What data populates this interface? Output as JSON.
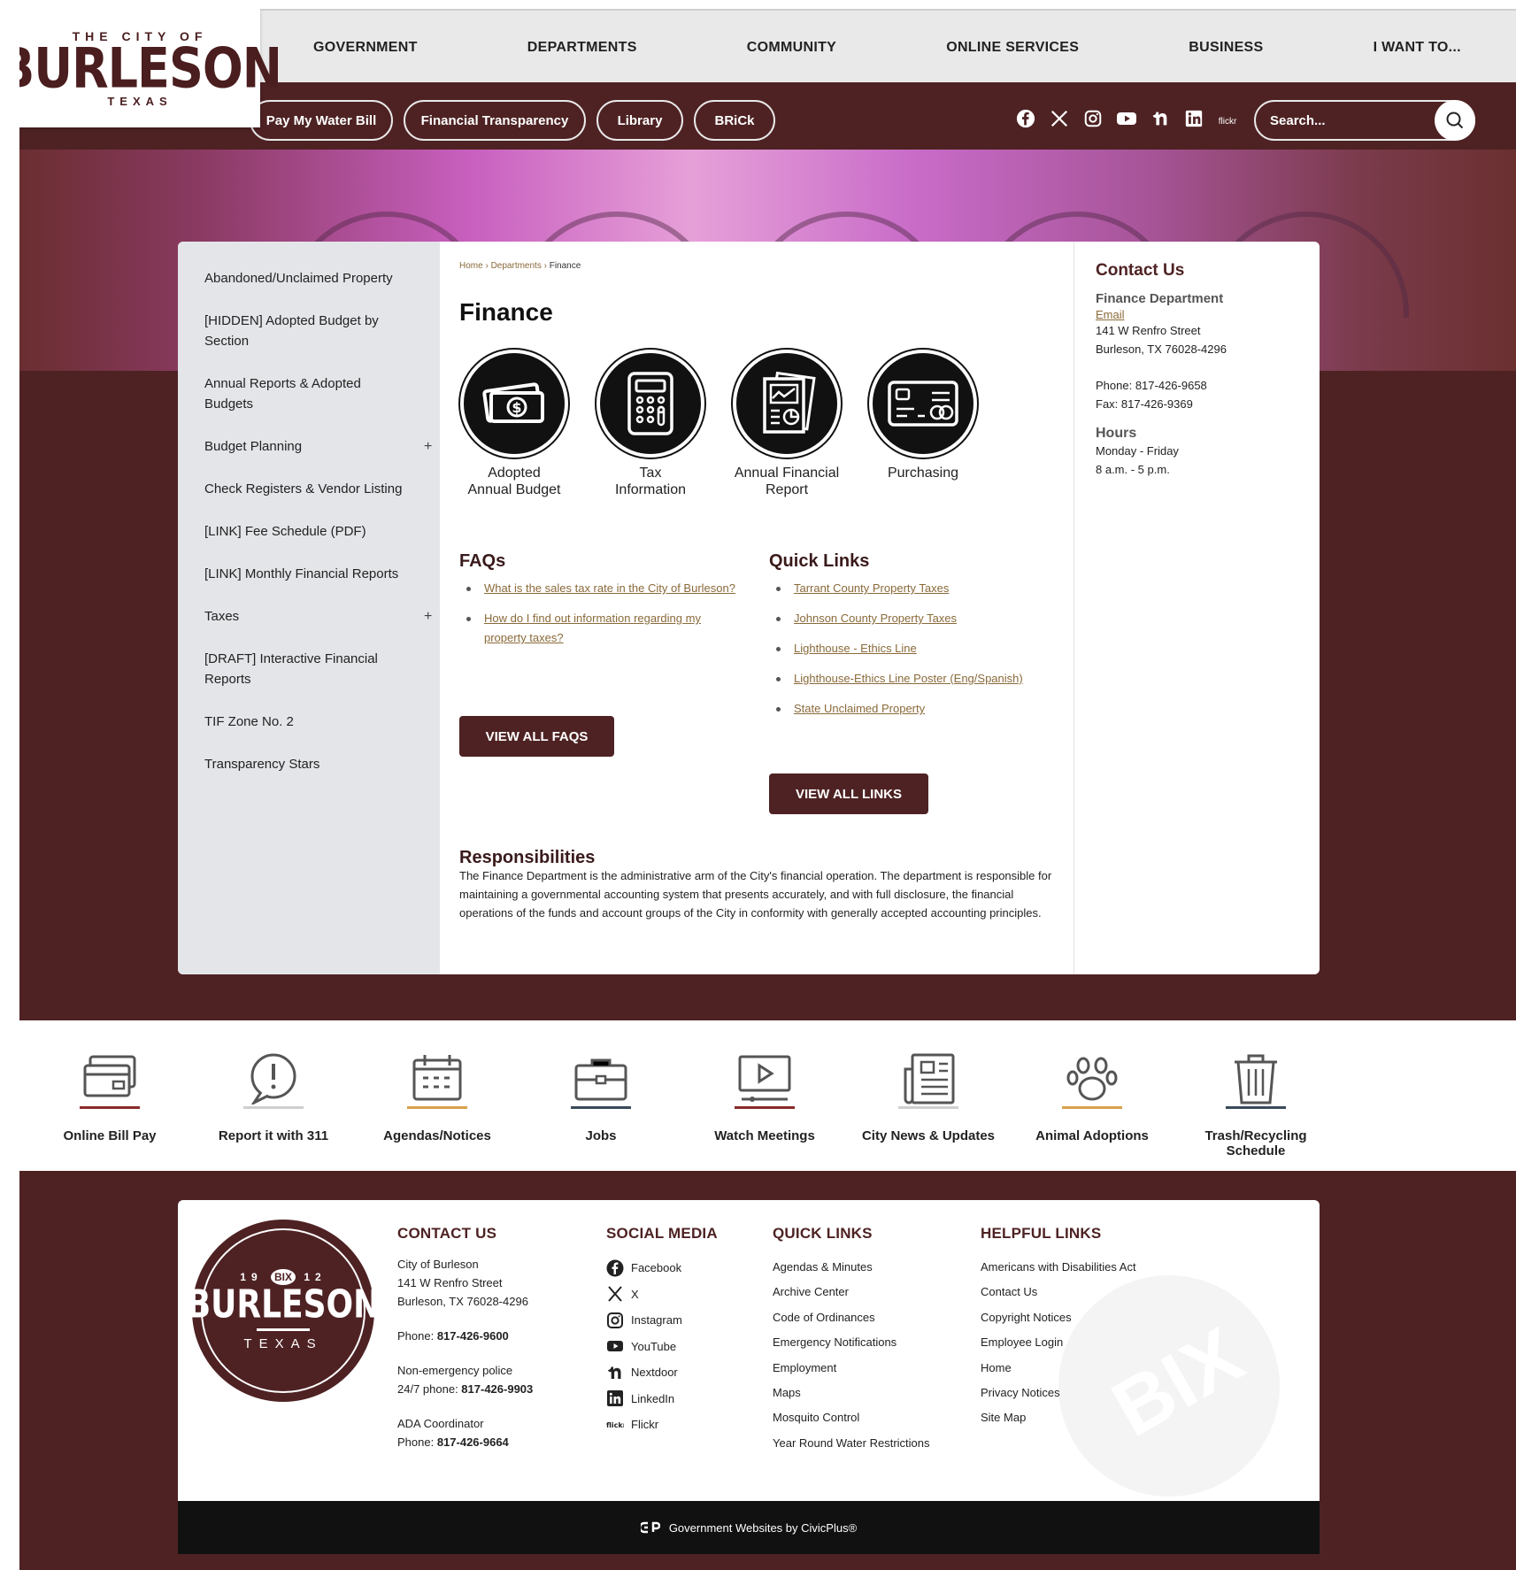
{
  "logo": {
    "top": "THE CITY OF",
    "name": "BURLESON",
    "state": "TEXAS"
  },
  "nav": [
    "GOVERNMENT",
    "DEPARTMENTS",
    "COMMUNITY",
    "ONLINE SERVICES",
    "BUSINESS",
    "I WANT TO..."
  ],
  "pills": [
    "Pay My Water Bill",
    "Financial Transparency",
    "Library",
    "BRiCk"
  ],
  "social_icons": [
    "facebook-icon",
    "x-icon",
    "instagram-icon",
    "youtube-icon",
    "nextdoor-icon",
    "linkedin-icon",
    "flickr-icon"
  ],
  "social_flickr_label": "flickr",
  "search": {
    "placeholder": "Search..."
  },
  "sidebar": {
    "items": [
      {
        "label": "Abandoned/Unclaimed Property",
        "expand": ""
      },
      {
        "label": "[HIDDEN] Adopted Budget by Section",
        "expand": ""
      },
      {
        "label": "Annual Reports & Adopted Budgets",
        "expand": ""
      },
      {
        "label": "Budget Planning",
        "expand": "+"
      },
      {
        "label": "Check Registers & Vendor Listing",
        "expand": ""
      },
      {
        "label": "[LINK] Fee Schedule (PDF)",
        "expand": ""
      },
      {
        "label": "[LINK] Monthly Financial Reports",
        "expand": ""
      },
      {
        "label": "Taxes",
        "expand": "+"
      },
      {
        "label": "[DRAFT] Interactive Financial Reports",
        "expand": ""
      },
      {
        "label": "TIF Zone No. 2",
        "expand": ""
      },
      {
        "label": "Transparency Stars",
        "expand": ""
      }
    ]
  },
  "breadcrumb": {
    "home": "Home",
    "sep": " › ",
    "departments": "Departments",
    "current": "Finance"
  },
  "page_title": "Finance",
  "icon_buttons": [
    {
      "label": "Adopted\nAnnual Budget",
      "icon": "money-icon"
    },
    {
      "label": "Tax\nInformation",
      "icon": "calculator-icon"
    },
    {
      "label": "Annual Financial\nReport",
      "icon": "report-icon"
    },
    {
      "label": "Purchasing",
      "icon": "credit-card-icon"
    }
  ],
  "faqs": {
    "heading": "FAQs",
    "items": [
      "What is the sales tax rate in the City of Burleson?",
      "How do I find out information regarding my property taxes?"
    ],
    "button": "VIEW ALL FAQS"
  },
  "quick_links": {
    "heading": "Quick Links",
    "items": [
      "Tarrant County Property Taxes",
      "Johnson County Property Taxes",
      "Lighthouse - Ethics Line",
      "Lighthouse-Ethics Line Poster (Eng/Spanish)",
      "State Unclaimed Property"
    ],
    "button": "VIEW ALL LINKS"
  },
  "responsibilities": {
    "heading": "Responsibilities",
    "text": "The Finance Department is the administrative arm of the City's financial operation. The department is responsible for maintaining a governmental accounting system that presents accurately, and with full disclosure, the financial operations of the funds and account groups of the City in conformity with generally accepted accounting principles."
  },
  "contact": {
    "heading": "Contact Us",
    "dept": "Finance Department",
    "email": "Email",
    "address1": "141 W Renfro Street",
    "address2": "Burleson, TX 76028-4296",
    "phone": "Phone: 817-426-9658",
    "fax": "Fax: 817-426-9369",
    "hours_heading": "Hours",
    "hours1": "Monday - Friday",
    "hours2": "8 a.m. - 5 p.m."
  },
  "quick_icons": [
    {
      "label": "Online Bill Pay",
      "icon": "bill-pay-icon",
      "accent": "#8a2a2a"
    },
    {
      "label": "Report it with 311",
      "icon": "alert-bubble-icon",
      "accent": "#cfcfcf"
    },
    {
      "label": "Agendas/Notices",
      "icon": "calendar-icon",
      "accent": "#d9a24a"
    },
    {
      "label": "Jobs",
      "icon": "briefcase-icon",
      "accent": "#3a4a5a"
    },
    {
      "label": "Watch Meetings",
      "icon": "video-icon",
      "accent": "#8a2a2a"
    },
    {
      "label": "City News & Updates",
      "icon": "newspaper-icon",
      "accent": "#cfcfcf"
    },
    {
      "label": "Animal Adoptions",
      "icon": "paw-icon",
      "accent": "#d9a24a"
    },
    {
      "label": "Trash/Recycling Schedule",
      "icon": "trash-icon",
      "accent": "#3a4a5a"
    }
  ],
  "footer": {
    "seal": {
      "left": "19",
      "right": "12",
      "mid": "BIX",
      "name": "BURLESON",
      "state": "TEXAS"
    },
    "contact": {
      "heading": "CONTACT US",
      "l1": "City of Burleson",
      "l2": "141 W Renfro Street",
      "l3": "Burleson, TX 76028-4296",
      "phone_label": "Phone: ",
      "phone": "817-426-9600",
      "police1": "Non-emergency police",
      "police2_label": "24/7 phone: ",
      "police2": "817-426-9903",
      "ada1": "ADA Coordinator",
      "ada2_label": "Phone: ",
      "ada2": "817-426-9664"
    },
    "social": {
      "heading": "SOCIAL MEDIA",
      "items": [
        {
          "label": "Facebook",
          "icon": "facebook-icon"
        },
        {
          "label": "X",
          "icon": "x-icon"
        },
        {
          "label": "Instagram",
          "icon": "instagram-icon"
        },
        {
          "label": "YouTube",
          "icon": "youtube-icon"
        },
        {
          "label": "Nextdoor",
          "icon": "nextdoor-icon"
        },
        {
          "label": "LinkedIn",
          "icon": "linkedin-icon"
        },
        {
          "label": "Flickr",
          "icon": "flickr-icon"
        }
      ]
    },
    "quick": {
      "heading": "QUICK LINKS",
      "items": [
        "Agendas & Minutes",
        "Archive Center",
        "Code of Ordinances",
        "Emergency Notifications",
        "Employment",
        "Maps",
        "Mosquito Control",
        "Year Round Water Restrictions"
      ]
    },
    "helpful": {
      "heading": "HELPFUL LINKS",
      "items": [
        "Americans with Disabilities Act",
        "Contact Us",
        "Copyright Notices",
        "Employee Login",
        "Home",
        "Privacy Notices",
        "Site Map"
      ]
    },
    "watermark": "BIX",
    "credit": "Government Websites by CivicPlus®"
  }
}
